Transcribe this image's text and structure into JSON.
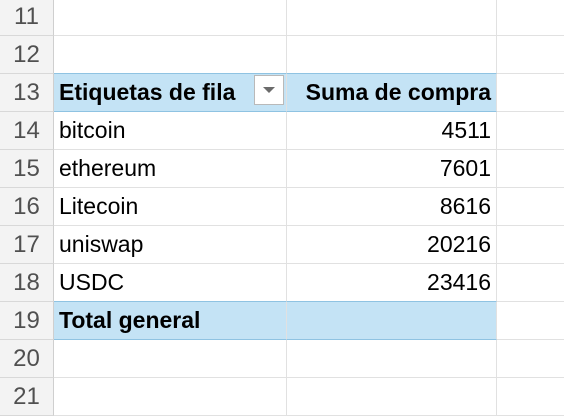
{
  "rows": {
    "r11": "11",
    "r12": "12",
    "r13": "13",
    "r14": "14",
    "r15": "15",
    "r16": "16",
    "r17": "17",
    "r18": "18",
    "r19": "19",
    "r20": "20",
    "r21": "21"
  },
  "pivot": {
    "row_labels_header": "Etiquetas de fila",
    "value_header": "Suma de compra",
    "items": [
      {
        "label": "bitcoin",
        "value": "4511"
      },
      {
        "label": "ethereum",
        "value": "7601"
      },
      {
        "label": "Litecoin",
        "value": "8616"
      },
      {
        "label": "uniswap",
        "value": "20216"
      },
      {
        "label": "USDC",
        "value": "23416"
      }
    ],
    "total_label": "Total general",
    "total_value": ""
  },
  "icons": {
    "filter": "dropdown-arrow-icon"
  },
  "colors": {
    "pivot_header_bg": "#c4e3f5",
    "pivot_border": "#8fc3e2"
  }
}
